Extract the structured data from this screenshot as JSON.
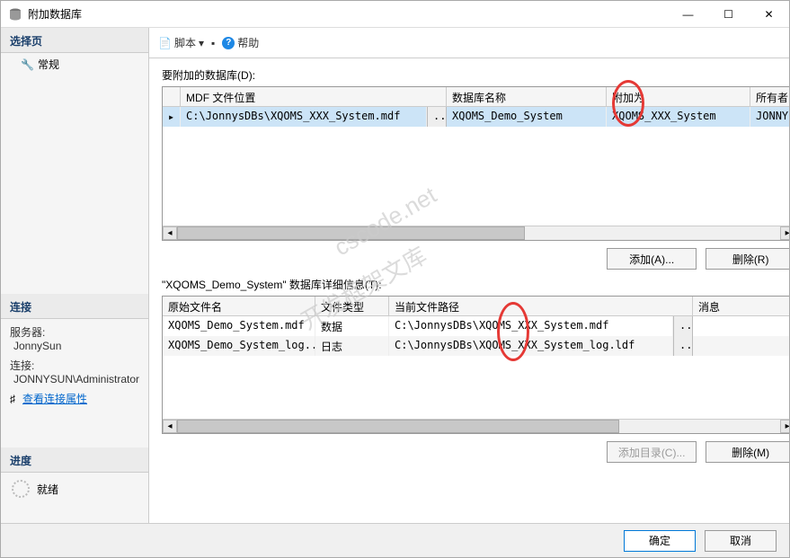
{
  "window": {
    "title": "附加数据库"
  },
  "winControls": {
    "min": "—",
    "max": "☐",
    "close": "✕"
  },
  "sidebar": {
    "selectPage": "选择页",
    "general": "常规",
    "connection": "连接",
    "serverLabel": "服务器:",
    "serverValue": "JonnySun",
    "connLabel": "连接:",
    "connValue": "JONNYSUN\\Administrator",
    "viewProps": "查看连接属性",
    "progress": "进度",
    "ready": "就绪"
  },
  "toolbar": {
    "script": "脚本",
    "help": "帮助"
  },
  "section1": {
    "label": "要附加的数据库(D):",
    "cols": {
      "mdf": "MDF 文件位置",
      "dbname": "数据库名称",
      "attachAs": "附加为",
      "owner": "所有者"
    },
    "row": {
      "mdf": "C:\\JonnysDBs\\XQOMS_XXX_System.mdf",
      "browse": "...",
      "dbname": "XQOMS_Demo_System",
      "attachAs": "XQOMS_XXX_System",
      "owner": "JONNY"
    },
    "addBtn": "添加(A)...",
    "removeBtn": "删除(R)"
  },
  "section2": {
    "label": "\"XQOMS_Demo_System\" 数据库详细信息(T):",
    "cols": {
      "orig": "原始文件名",
      "type": "文件类型",
      "path": "当前文件路径",
      "msg": "消息"
    },
    "rows": [
      {
        "orig": "XQOMS_Demo_System.mdf",
        "type": "数据",
        "path": "C:\\JonnysDBs\\XQOMS_XXX_System.mdf",
        "browse": "..."
      },
      {
        "orig": "XQOMS_Demo_System_log...",
        "type": "日志",
        "path": "C:\\JonnysDBs\\XQOMS_XXX_System_log.ldf",
        "browse": "..."
      }
    ],
    "addDirBtn": "添加目录(C)...",
    "removeBtn": "删除(M)"
  },
  "footer": {
    "ok": "确定",
    "cancel": "取消"
  }
}
